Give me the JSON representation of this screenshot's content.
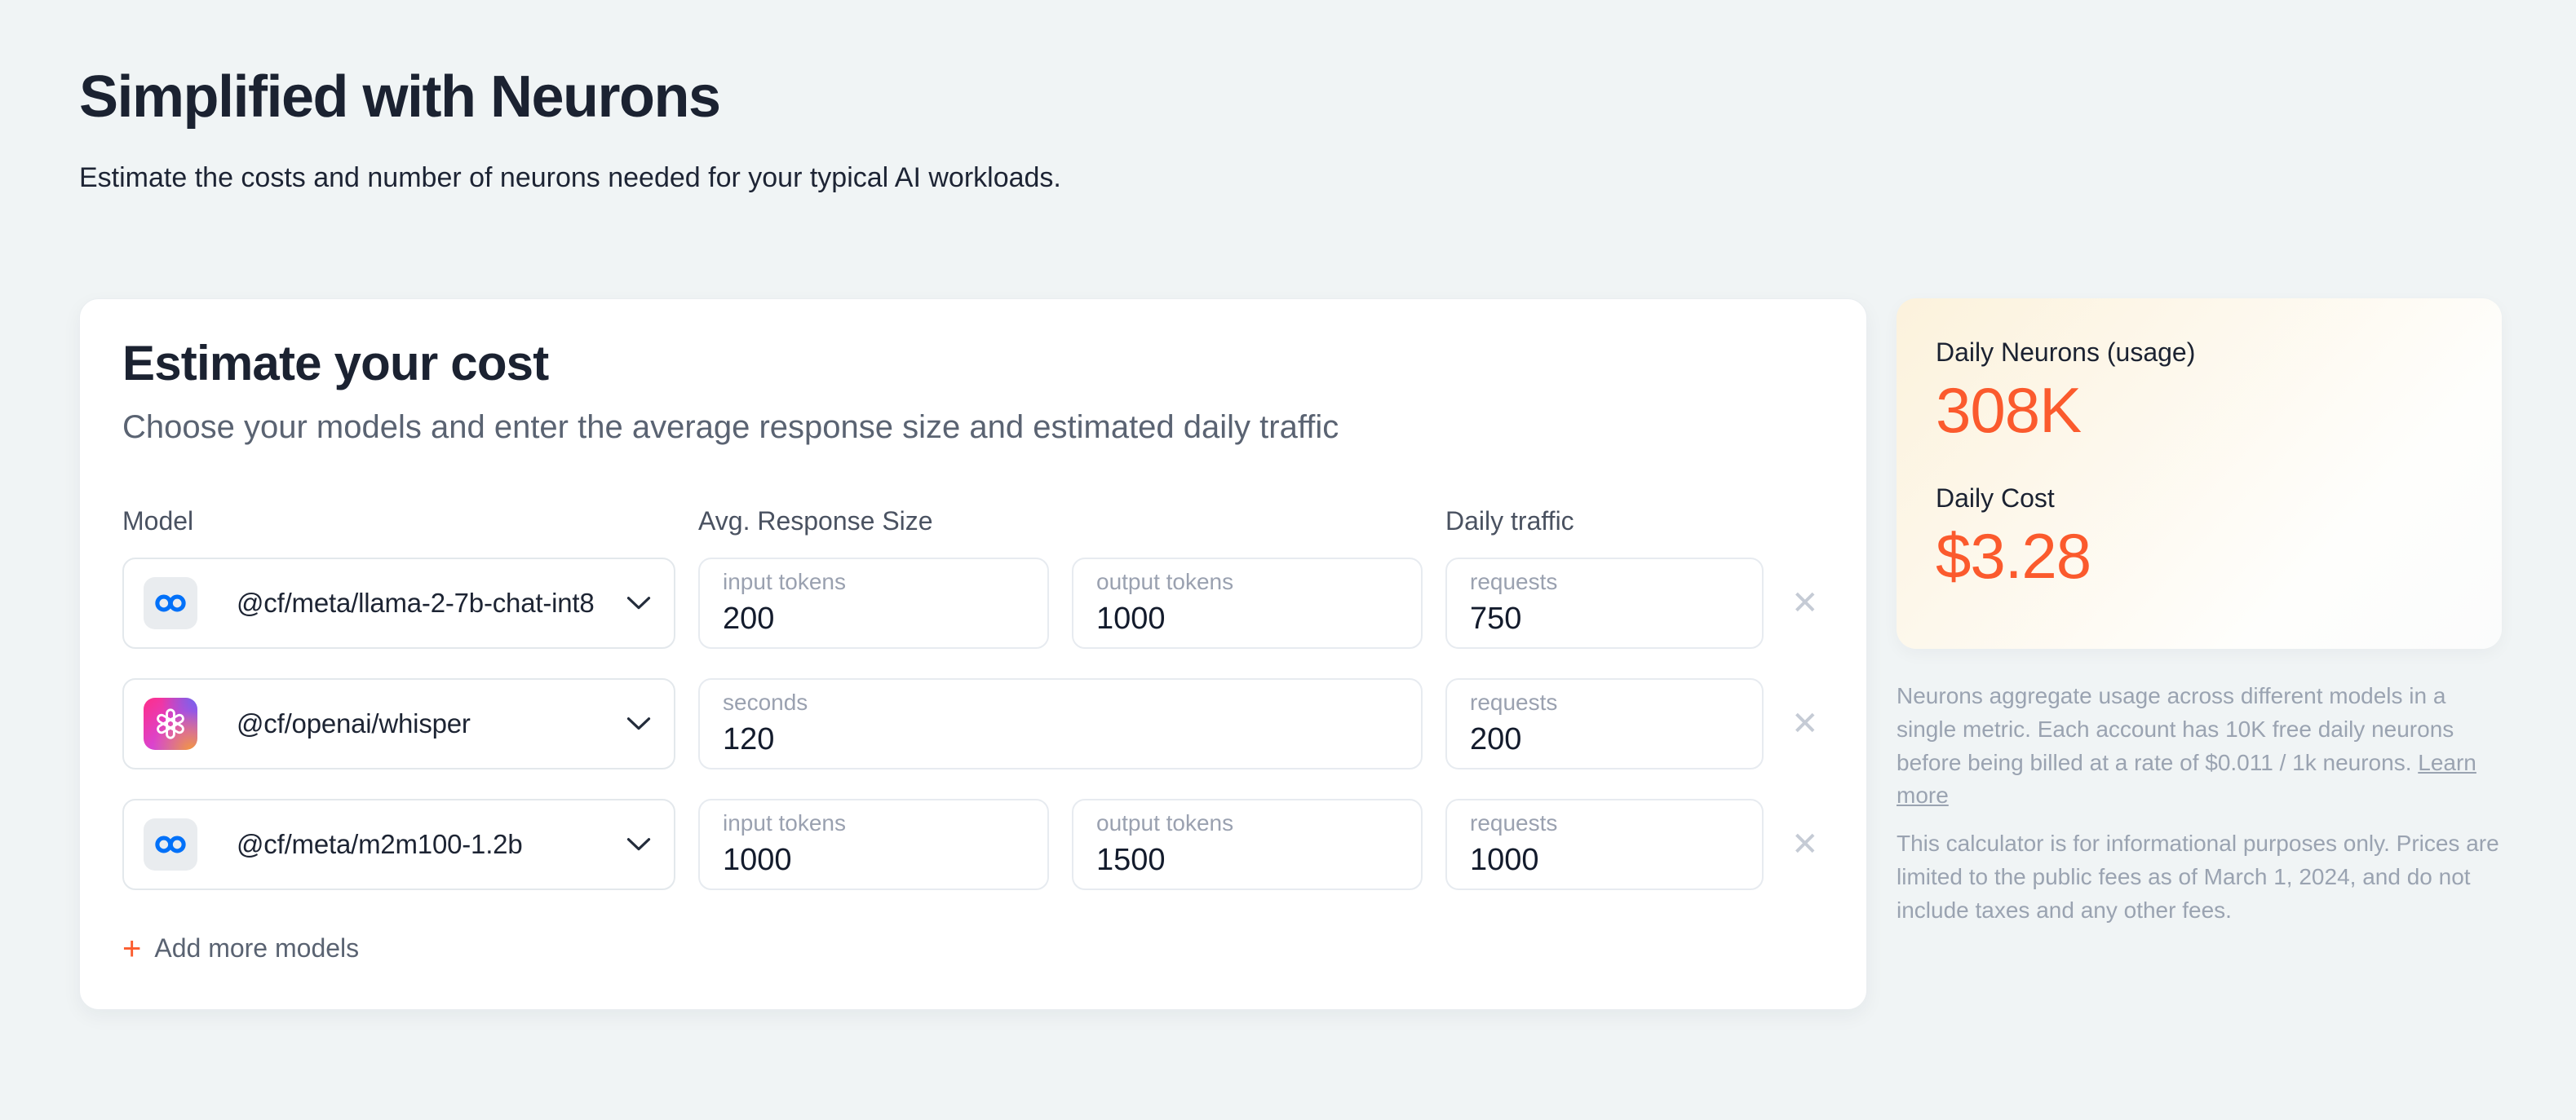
{
  "page": {
    "title": "Simplified with Neurons",
    "subtitle": "Estimate the costs and number of neurons needed for your typical AI workloads."
  },
  "calculator": {
    "title": "Estimate your cost",
    "subtitle": "Choose your models and enter the average response size and estimated daily traffic",
    "columns": {
      "model": "Model",
      "response_size": "Avg. Response Size",
      "daily_traffic": "Daily traffic"
    },
    "rows": [
      {
        "model": "@cf/meta/llama-2-7b-chat-int8",
        "icon": "meta-logo",
        "fields": [
          {
            "label": "input tokens",
            "value": "200"
          },
          {
            "label": "output tokens",
            "value": "1000"
          }
        ],
        "traffic": {
          "label": "requests",
          "value": "750"
        }
      },
      {
        "model": "@cf/openai/whisper",
        "icon": "openai-logo",
        "fields": [
          {
            "label": "seconds",
            "value": "120"
          }
        ],
        "traffic": {
          "label": "requests",
          "value": "200"
        }
      },
      {
        "model": "@cf/meta/m2m100-1.2b",
        "icon": "meta-logo",
        "fields": [
          {
            "label": "input tokens",
            "value": "1000"
          },
          {
            "label": "output tokens",
            "value": "1500"
          }
        ],
        "traffic": {
          "label": "requests",
          "value": "1000"
        }
      }
    ],
    "add_more_plus": "+",
    "add_more_label": "Add more models"
  },
  "summary": {
    "neurons_label": "Daily Neurons (usage)",
    "neurons_value": "308K",
    "cost_label": "Daily Cost",
    "cost_value": "$3.28"
  },
  "footnotes": {
    "p1_before_link": "Neurons aggregate usage across different models in a single metric. Each account has 10K free daily neurons before being billed at a rate of $0.011 / 1k neurons. ",
    "p1_link": "Learn more",
    "p2": "This calculator is for informational purposes only. Prices are limited to the public fees as of March 1, 2024, and do not include taxes and any other fees."
  },
  "ui": {
    "remove_glyph": "✕"
  },
  "colors": {
    "accent_orange": "#fb5a2d",
    "meta_blue": "#0271f9",
    "page_background": "#f0f4f5",
    "summary_card_cream": "#fcf2dc"
  }
}
